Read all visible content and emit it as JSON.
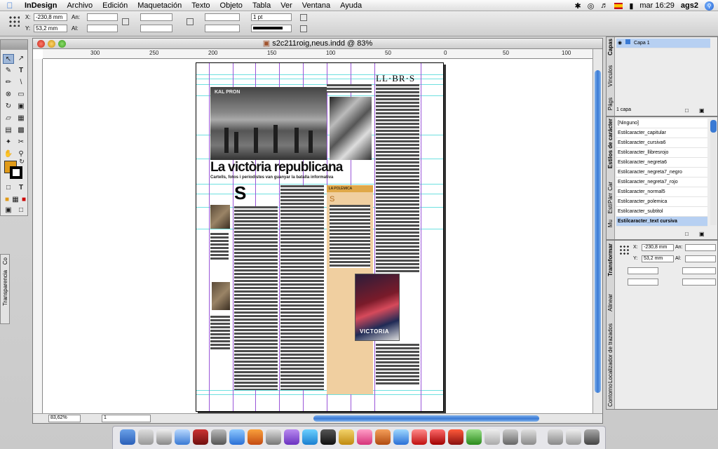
{
  "menubar": {
    "app": "InDesign",
    "items": [
      "Archivo",
      "Edición",
      "Maquetación",
      "Texto",
      "Objeto",
      "Tabla",
      "Ver",
      "Ventana",
      "Ayuda"
    ],
    "clock": "mar 16:29",
    "user": "ags2"
  },
  "control": {
    "x_label": "X:",
    "x_value": "-230,8 mm",
    "y_label": "Y:",
    "y_value": "53,2 mm",
    "w_label": "An:",
    "h_label": "Al:",
    "stroke_weight": "1 pt"
  },
  "document": {
    "title": "s2c211roig,neus.indd @ 83%",
    "zoom": "83,62%",
    "page_number": "1",
    "ruler_ticks": [
      "300",
      "250",
      "200",
      "150",
      "100",
      "50",
      "0",
      "50",
      "100"
    ]
  },
  "page_content": {
    "logo": "LL·BR·S",
    "headline": "La victòria republicana",
    "subhead": "Cartells, fotos i periodistes van guanyar la batalla informativa",
    "dropcap": "S",
    "polemica_head": "LA POLÈMICA",
    "polemica_dropcap": "S",
    "photo_sign": "KAL PRON",
    "poster_text": "VICTORIA"
  },
  "layers_panel": {
    "tab_capas": "Capas",
    "tab_vinculos": "Vínculos",
    "tab_pags": "Págs",
    "layer_name": "Capa 1",
    "layer_count": "1 capa"
  },
  "styles_panel": {
    "tab_label": "Estilos de carácter",
    "tab_short": [
      "Car",
      "Párr",
      "Esti",
      "Mu"
    ],
    "items": [
      "[Ninguno]",
      "Estilcaracter_capitular",
      "Estilcaracter_cursiva6",
      "Estilcaracter_llibresrojo",
      "Estilcaracter_negreta6",
      "Estilcaracter_negreta7_negro",
      "Estilcaracter_negreta7_rojo",
      "Estilcaracter_normal5",
      "Estilcaracter_polemica",
      "Estilcaracter_subtitol",
      "Estilcaracter_text cursiva"
    ],
    "selected_index": 10
  },
  "transform_panel": {
    "tab_transformar": "Transformar",
    "tab_alinear": "Alinear",
    "tab_localizador": "Localizador de trazados",
    "tab_contorno": "Contorno",
    "x_label": "X:",
    "x_value": "-230,8 mm",
    "y_label": "Y:",
    "y_value": "53,2 mm",
    "w_label": "An:",
    "h_label": "Al:"
  },
  "transparency_tab": {
    "label": "Transparencia",
    "short": "Co"
  },
  "colors": {
    "fill": "#e09a18",
    "guide_cyan": "#6ee0e0",
    "guide_purple": "#9a55d8",
    "selection": "#b7d0f2"
  }
}
